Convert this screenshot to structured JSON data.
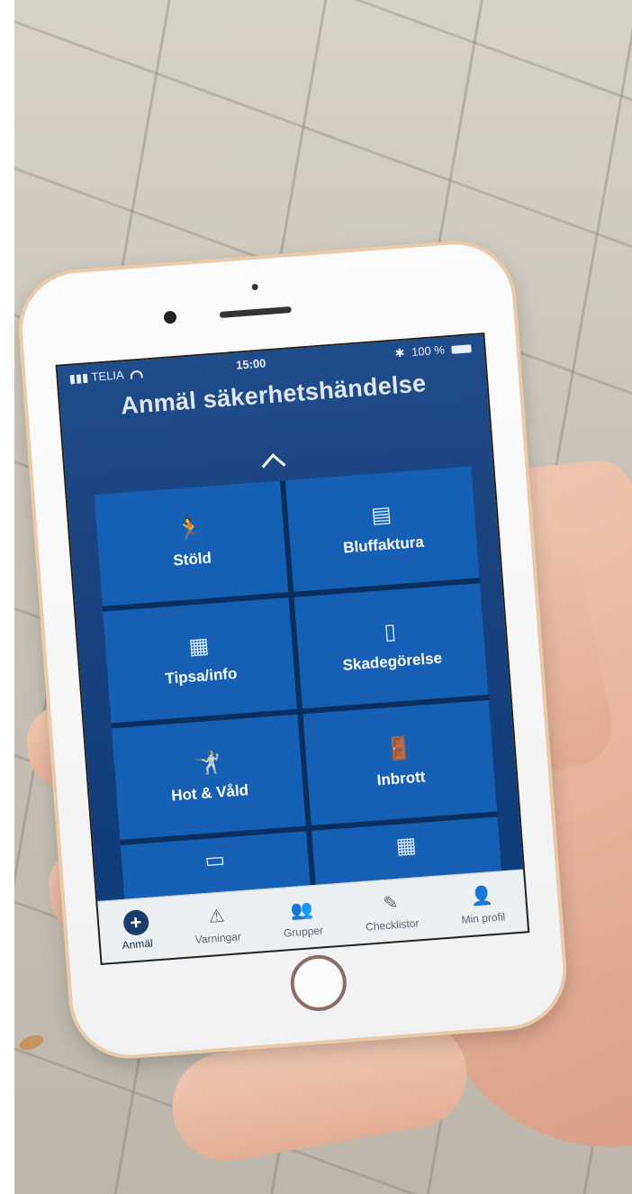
{
  "status_bar": {
    "carrier": "TELIA",
    "time": "15:00",
    "battery": "100 %"
  },
  "header": {
    "title": "Anmäl säkerhetshändelse"
  },
  "tiles": [
    {
      "label": "Stöld",
      "icon": "running-thief-icon"
    },
    {
      "label": "Bluffaktura",
      "icon": "receipt-icon"
    },
    {
      "label": "Tipsa/info",
      "icon": "storefront-icon"
    },
    {
      "label": "Skadegörelse",
      "icon": "spray-can-icon"
    },
    {
      "label": "Hot & Våld",
      "icon": "assault-person-icon"
    },
    {
      "label": "Inbrott",
      "icon": "burglar-door-icon"
    },
    {
      "label": "",
      "icon": "card-skull-icon"
    },
    {
      "label": "",
      "icon": "storefront-icon"
    }
  ],
  "tabbar": {
    "items": [
      {
        "label": "Anmäl",
        "icon": "plus-icon",
        "active": true
      },
      {
        "label": "Varningar",
        "icon": "warning-icon",
        "active": false
      },
      {
        "label": "Grupper",
        "icon": "group-icon",
        "active": false
      },
      {
        "label": "Checklistor",
        "icon": "checklist-icon",
        "active": false
      },
      {
        "label": "Min profil",
        "icon": "profile-icon",
        "active": false
      }
    ]
  },
  "colors": {
    "accent": "#1560b5",
    "background": "#1b4480",
    "tabbar": "#eceff2"
  }
}
